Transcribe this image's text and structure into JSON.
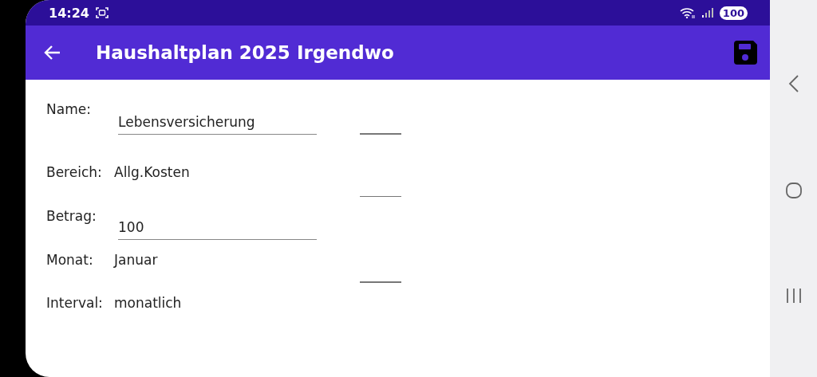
{
  "status_bar": {
    "time": "14:24",
    "battery": "100"
  },
  "app_bar": {
    "title": "Haushaltplan 2025 Irgendwo"
  },
  "form": {
    "rows": [
      {
        "label": "Name:",
        "kind": "input",
        "value": "Lebensversicherung"
      },
      {
        "label": "Bereich:",
        "kind": "text",
        "value": "Allg.Kosten"
      },
      {
        "label": "Betrag:",
        "kind": "input",
        "value": "100"
      },
      {
        "label": "Monat:",
        "kind": "text",
        "value": "Januar"
      },
      {
        "label": "Interval:",
        "kind": "text",
        "value": "monatlich"
      }
    ]
  }
}
